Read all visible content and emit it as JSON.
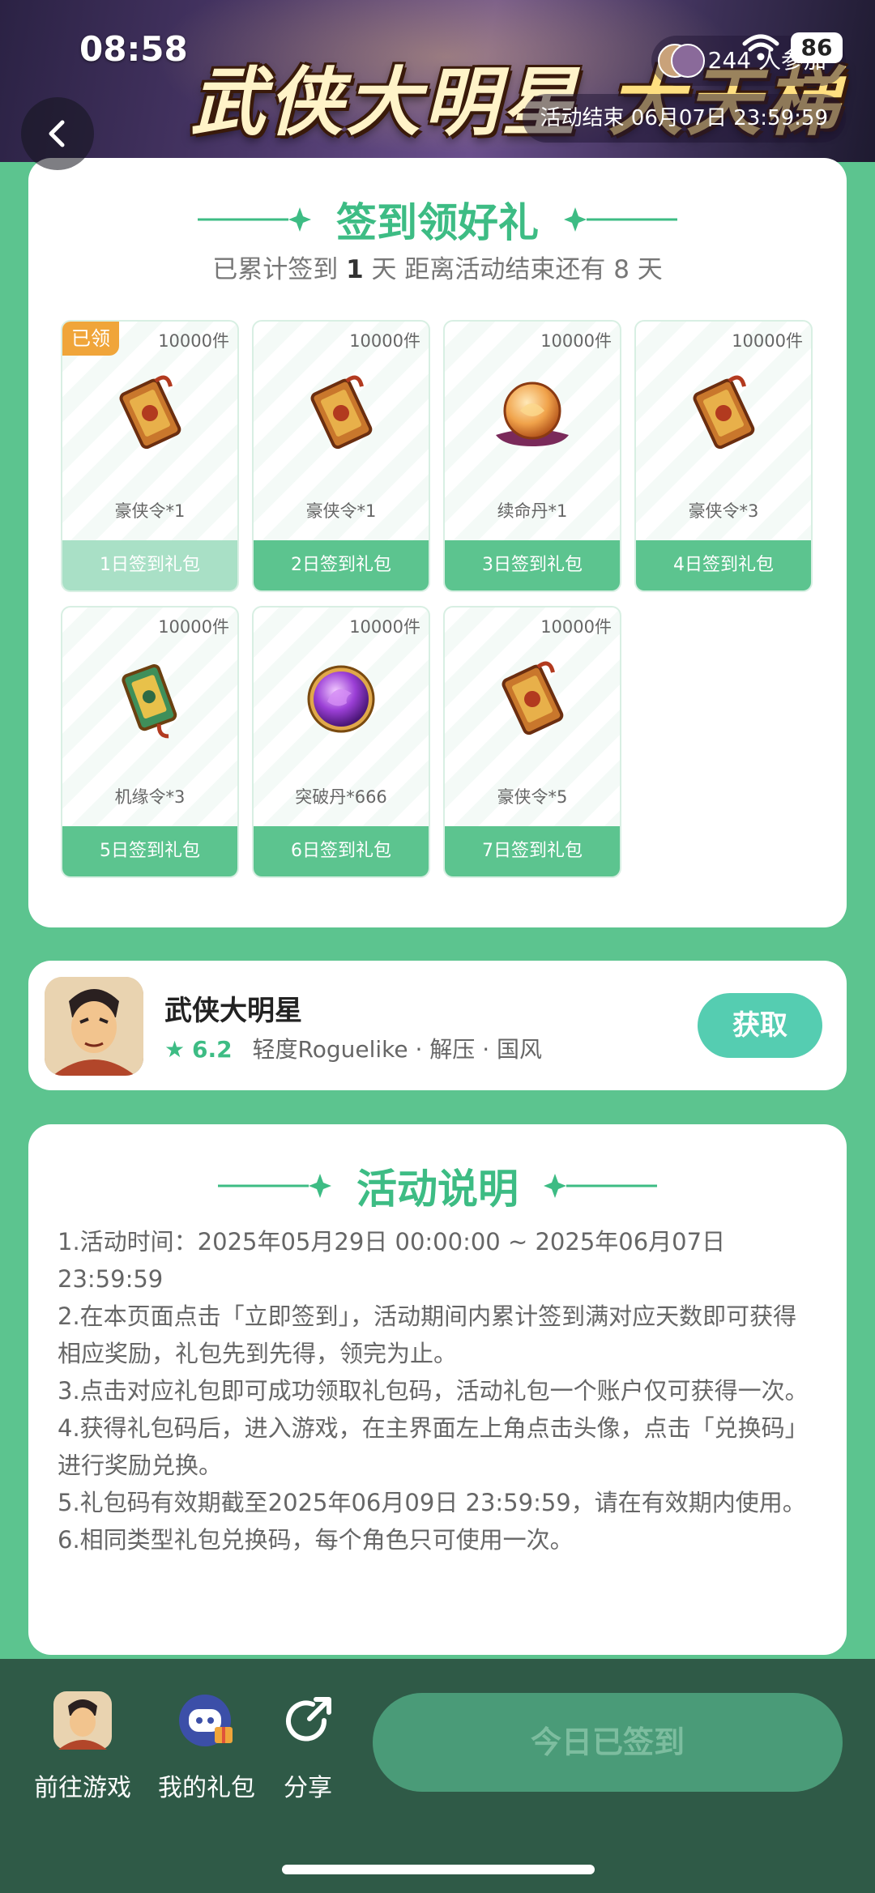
{
  "status_bar": {
    "time": "08:58",
    "battery": "86"
  },
  "banner": {
    "title_main": "武侠大明星",
    "title_sub": "大天梯",
    "participants": "244 人参加",
    "end_time": "活动结束 06月07日 23:59:59"
  },
  "checkin": {
    "heading": "签到领好礼",
    "sub_prefix": "已累计签到",
    "days_signed": "1",
    "sub_mid": "天  距离活动结束还有 8 天",
    "claimed_label": "已领",
    "gifts": [
      {
        "qty": "10000件",
        "name": "豪侠令*1",
        "button": "1日签到礼包",
        "claimed": true,
        "art": "token-icon"
      },
      {
        "qty": "10000件",
        "name": "豪侠令*1",
        "button": "2日签到礼包",
        "claimed": false,
        "art": "token-icon"
      },
      {
        "qty": "10000件",
        "name": "续命丹*1",
        "button": "3日签到礼包",
        "claimed": false,
        "art": "orb-icon"
      },
      {
        "qty": "10000件",
        "name": "豪侠令*3",
        "button": "4日签到礼包",
        "claimed": false,
        "art": "token-icon"
      },
      {
        "qty": "10000件",
        "name": "机缘令*3",
        "button": "5日签到礼包",
        "claimed": false,
        "art": "jade-token-icon"
      },
      {
        "qty": "10000件",
        "name": "突破丹*666",
        "button": "6日签到礼包",
        "claimed": false,
        "art": "purple-orb-icon"
      },
      {
        "qty": "10000件",
        "name": "豪侠令*5",
        "button": "7日签到礼包",
        "claimed": false,
        "art": "token-icon"
      }
    ]
  },
  "game": {
    "name": "武侠大明星",
    "rating": "6.2",
    "tags": "轻度Roguelike · 解压 · 国风",
    "get_button": "获取"
  },
  "rules": {
    "heading": "活动说明",
    "items": [
      "1.活动时间：2025年05月29日 00:00:00 ~ 2025年06月07日 23:59:59",
      "2.在本页面点击「立即签到」，活动期间内累计签到满对应天数即可获得相应奖励，礼包先到先得，领完为止。",
      "3.点击对应礼包即可成功领取礼包码，活动礼包一个账户仅可获得一次。",
      "4.获得礼包码后，进入游戏，在主界面左上角点击头像，点击「兑换码」进行奖励兑换。",
      "5.礼包码有效期截至2025年06月09日 23:59:59，请在有效期内使用。",
      "6.相同类型礼包兑换码，每个角色只可使用一次。"
    ]
  },
  "bottom_bar": {
    "go_game": "前往游戏",
    "my_gifts": "我的礼包",
    "share": "分享",
    "signed": "今日已签到"
  },
  "colors": {
    "accent": "#3dbc84",
    "page_bg": "#5cc48f",
    "bottom_bar": "#2f5a47",
    "claimed_badge": "#f0a53a"
  }
}
